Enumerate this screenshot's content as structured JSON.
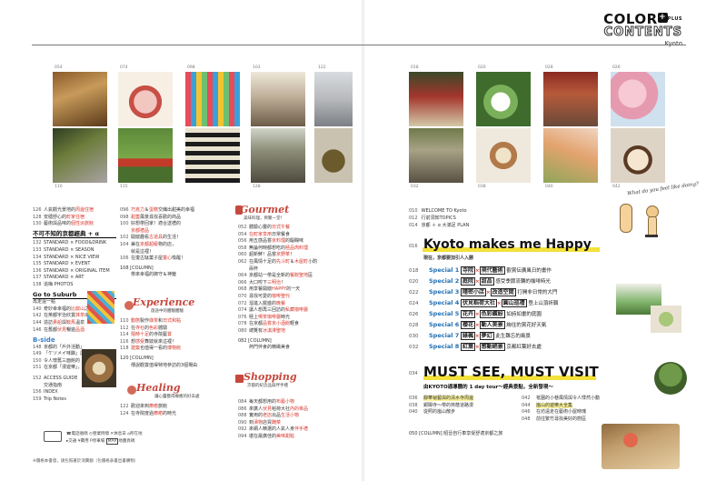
{
  "header": {
    "logo_line1": "COLOR",
    "logo_plus": "+",
    "logo_plus_word": "PLUS",
    "logo_line2": "CONTENTS",
    "logo_line3": "Kyoto"
  },
  "photo_pages": {
    "left_top": [
      "054",
      "074",
      "098",
      "103",
      "122"
    ],
    "left_bottom": [
      "110",
      "115",
      "",
      "128",
      ""
    ],
    "right_top": [
      "018",
      "020",
      "028",
      "026"
    ],
    "right_bottom": [
      "032",
      "038",
      "040",
      "042"
    ]
  },
  "col1": {
    "items_a": [
      {
        "num": "126",
        "pre": "人氣觀光景地的",
        "hl": "周邊住宿",
        "post": ""
      },
      {
        "num": "128",
        "pre": "安穩舒心的",
        "hl": "町家住宿",
        "post": ""
      },
      {
        "num": "130",
        "pre": "藝術與品味的",
        "hl": "個性派旅館",
        "post": ""
      }
    ],
    "section": "不可不知的京都經典 + α",
    "items_b": [
      {
        "num": "132",
        "text": "STANDARD × FOOD&DRINK"
      },
      {
        "num": "133",
        "text": "STANDARD × SEASON"
      },
      {
        "num": "134",
        "text": "STANDARD × NICE VIEW"
      },
      {
        "num": "135",
        "text": "STANDARD × EVENT"
      },
      {
        "num": "136",
        "text": "STANDARD × ORIGINAL ITEM"
      },
      {
        "num": "137",
        "text": "STANDARD × ART"
      },
      {
        "num": "138",
        "text": "追梅 PHOTOS"
      }
    ],
    "goto_title": "Go to Suburb",
    "goto_sub": "再走遠一點",
    "items_c": [
      {
        "num": "140",
        "pre": "奇妙幸幸福的",
        "hl": "比叡山",
        "post": "之旅"
      },
      {
        "num": "142",
        "pre": "在英都宇治欣賞",
        "hl": "抹茶",
        "post": "出品"
      },
      {
        "num": "144",
        "pre": "造訪",
        "hl": "貴船",
        "post": "與",
        "hl2": "鞍馬",
        "post2": "溫泉"
      },
      {
        "num": "146",
        "pre": "在舊都",
        "hl": "伏見",
        "post": "暢遊",
        "hl2": "品酒",
        "post2": ""
      }
    ],
    "bside_title": "B-side",
    "items_d": [
      {
        "num": "148",
        "text": "京都的「戶外活動」"
      },
      {
        "num": "149",
        "text": "「ケツメイ味醂」與傳統酒的魅力"
      },
      {
        "num": "150",
        "text": "令人懷舊三面館的「溫泉」小店"
      },
      {
        "num": "151",
        "text": "在京都「漫遊樂」，找好去處 2"
      }
    ],
    "items_e": [
      {
        "num": "152",
        "text": "ACCESS GUIDE"
      },
      {
        "num": "",
        "text": "交通指南"
      },
      {
        "num": "156",
        "text": "INDEX"
      },
      {
        "num": "159",
        "text": "Trip Notes"
      }
    ]
  },
  "col2": {
    "items_a": [
      {
        "num": "096",
        "pre": "",
        "hl": "巧克力",
        "post": "＆",
        "hl2": "蛋糕",
        "post2": "交織出甜美的幸福"
      },
      {
        "num": "098",
        "pre": "",
        "hl": "甜蓋",
        "post": "風景尋找喜歡的商品",
        "hl2": "",
        "post2": ""
      },
      {
        "num": "100",
        "pre": "好想帶回家！適合送禮的",
        "hl": "",
        "post": "",
        "hl2": "",
        "post2": ""
      },
      {
        "num": "",
        "pre": "",
        "hl": "京都禮品",
        "post": "",
        "hl2": "",
        "post2": ""
      },
      {
        "num": "102",
        "pre": "開啟趣看",
        "hl": "古道具",
        "post": "的生活！",
        "hl2": "",
        "post2": ""
      },
      {
        "num": "104",
        "pre": "兼在",
        "hl": "京都超級",
        "post": "物的店，",
        "hl2": "",
        "post2": ""
      },
      {
        "num": "",
        "pre": "就是這裡！",
        "hl": "",
        "post": "",
        "hl2": "",
        "post2": ""
      },
      {
        "num": "106",
        "pre": "在復古駄菓子屋",
        "hl": "童心",
        "post": "喚醒！",
        "hl2": "",
        "post2": ""
      }
    ],
    "column_a": "108 [COLUMN]",
    "column_a_sub": "帶來幸福的御守＆神籤",
    "experience_title": "Experience",
    "experience_sub": "旅途中的體驗體驗",
    "items_b": [
      {
        "num": "110",
        "pre": "",
        "hl": "動態",
        "post": "製作",
        "hl2": "綠茶",
        "post2": "和",
        "hl3": "日式和點"
      },
      {
        "num": "112",
        "pre": "在",
        "hl": "寺社",
        "post": "的",
        "hl2": "色彩",
        "post2": "體驗",
        "hl3": ""
      },
      {
        "num": "114",
        "pre": "",
        "hl": "隨時十足",
        "post": "的寺院藝",
        "hl2": "賞",
        "post2": "",
        "hl3": ""
      },
      {
        "num": "116",
        "pre": "想",
        "hl": "感受",
        "post": "舞妓",
        "hl2": "",
        "post2": "就來這裡！",
        "hl3": ""
      },
      {
        "num": "118",
        "pre": "",
        "hl": "建築",
        "post": "也值得一看的",
        "hl2": "博物館",
        "post2": "",
        "hl3": ""
      }
    ],
    "column_b": "120 [COLUMN]",
    "column_b_sub": "傳說觀賞值得特地參訪的3個場由",
    "healing_title": "Healing",
    "healing_sub": "讓心靈獲得療癒的好去處",
    "items_c": [
      {
        "num": "122",
        "pre": "歡迎來到",
        "hl": "療癒",
        "post": "旅館"
      },
      {
        "num": "124",
        "pre": "在寺院度過",
        "hl": "療癒",
        "post": "的時光"
      }
    ],
    "legend": [
      "電話號碼",
      "營業時間",
      "休息日",
      "所在地",
      "交通",
      "費用",
      "停車場",
      "MAP",
      "地圖頁碼"
    ]
  },
  "col3": {
    "gourmet_title": "Gourmet",
    "gourmet_sub": "美味料理，齊聚一堂！",
    "items_a": [
      {
        "num": "052",
        "pre": "體驗心靈的",
        "hl": "日式午餐",
        "post": ""
      },
      {
        "num": "054",
        "pre": "",
        "hl": "在町家享用",
        "post": "日常餐食"
      },
      {
        "num": "056",
        "pre": "用五感品嘗",
        "hl": "京料理",
        "post": "的醍醐味"
      },
      {
        "num": "058",
        "pre": "無論何時都想吃的",
        "hl": "極品肉料理",
        "post": ""
      },
      {
        "num": "060",
        "pre": "超新鮮！品嘗",
        "hl": "京野菜",
        "post": "！"
      },
      {
        "num": "062",
        "pre": "在風情十足的",
        "hl": "先斗町",
        "post": "＆",
        "hl2": "木屋町",
        "post2": "小酌"
      },
      {
        "num": "",
        "pre": "兩杯",
        "hl": "",
        "post": ""
      },
      {
        "num": "064",
        "pre": "京都站一帶是全新的",
        "hl": "餐飲聖地",
        "post": "區"
      },
      {
        "num": "066",
        "pre": "大口咬下",
        "hl": "三明治",
        "post": "！"
      },
      {
        "num": "068",
        "pre": "用享餐開啟",
        "hl": "HAPPY",
        "post": "的一天"
      },
      {
        "num": "070",
        "pre": "尋找可愛的",
        "hl": "咖啡聖代",
        "post": ""
      },
      {
        "num": "072",
        "pre": "溜進入擺盛的",
        "hl": "晚餐",
        "post": ""
      },
      {
        "num": "074",
        "pre": "讓人想再三回訪的",
        "hl": "私藏咖啡廳",
        "post": ""
      },
      {
        "num": "076",
        "pre": "極上",
        "hl": "喫茶咖啡廳",
        "post": "時光"
      },
      {
        "num": "078",
        "pre": "在京都",
        "hl": "品嘗京小酒館",
        "post": "輕食"
      },
      {
        "num": "080",
        "pre": "總覽有",
        "hl": "冰淇淋聖地",
        "post": ""
      }
    ],
    "column": "082 [COLUMN]",
    "column_sub": "熱門伴食的精緻美食",
    "shopping_title": "Shopping",
    "shopping_sub": "京都的紀念品與伴手禮",
    "items_b": [
      {
        "num": "084",
        "pre": "每天都想用的",
        "hl": "布藝小物",
        "post": ""
      },
      {
        "num": "086",
        "pre": "來廣人",
        "hl": "伏見",
        "post": "稻荷大社",
        "hl2": "內的單品",
        "post2": ""
      },
      {
        "num": "088",
        "pre": "實用的",
        "hl": "老店",
        "post": "出品",
        "hl2": "生活小物",
        "post2": ""
      },
      {
        "num": "090",
        "pre": "到",
        "hl": "漬物",
        "post": "店買",
        "hl2": "醃菜",
        "post2": ""
      },
      {
        "num": "092",
        "pre": "來網人精選的人氣人身",
        "hl": "伴手禮",
        "post": "",
        "hl2": "",
        "post2": ""
      },
      {
        "num": "094",
        "pre": "堪在最廣佳的",
        "hl": "美味甜點",
        "post": "",
        "hl2": "",
        "post2": ""
      }
    ]
  },
  "right": {
    "intro": [
      {
        "num": "010",
        "text": "WELCOME TO Kyoto"
      },
      {
        "num": "012",
        "text": "行前須知TOPICS"
      },
      {
        "num": "014",
        "text": "京都 ＋ α 大滿足 PLAN"
      }
    ],
    "happy_num": "016",
    "happy_title": "Kyoto makes me Happy",
    "happy_sub": "現在，京都要加引人入勝",
    "specials": [
      {
        "num": "018",
        "sp": "Special 1",
        "a": "寺院",
        "b": "現代藝術",
        "text": "觀賞伝廣風日的畫作"
      },
      {
        "num": "020",
        "sp": "Special 2",
        "a": "庭院",
        "b": "甜品",
        "text": "感受季節流轉的咖啡時光"
      },
      {
        "num": "022",
        "sp": "Special 3",
        "a": "隱密小店",
        "b": "改造空間",
        "text": "打開非日常的大門"
      },
      {
        "num": "024",
        "sp": "Special 4",
        "a": "伏見稻荷大社",
        "b": "圓山巡禮",
        "text": "登上山頂祈願"
      },
      {
        "num": "026",
        "sp": "Special 5",
        "a": "花卉",
        "b": "色彩繽紛",
        "text": "如詩如畫的庭園"
      },
      {
        "num": "028",
        "sp": "Special 6",
        "a": "櫻花",
        "b": "動人美景",
        "text": "絢往的賞花好天氣"
      },
      {
        "num": "030",
        "sp": "Special 7",
        "a": "綠楓",
        "b": "夢幻",
        "text": "此生難忘的風景"
      },
      {
        "num": "032",
        "sp": "Special 8",
        "a": "紅葉",
        "b": "感動絕景",
        "text": "京都紅葉好去處"
      }
    ],
    "must_num": "034",
    "must_title": "MUST SEE, MUST VISIT",
    "must_sub": "由KYOTO通導體的 1 day tour～經典景點，全新發現～",
    "must_left": [
      {
        "num": "036",
        "text": "靜華祕藝與的清水寺周邊"
      },
      {
        "num": "038",
        "text": "銀閣寺～帶的林蔭道路漫"
      },
      {
        "num": "040",
        "text": "從照的嵐山散步"
      }
    ],
    "must_right": [
      {
        "num": "042",
        "text": "祇園的小巷風情與令人悸然小動"
      },
      {
        "num": "044",
        "text": "嵐山的遊樂大全集"
      },
      {
        "num": "046",
        "text": "在坊遠走在藝術小屋時瑰"
      },
      {
        "num": "048",
        "text": "前往繁竹尋找美好的廚區"
      }
    ],
    "column": "050 [COLUMN] 昭晉自行車享受舒適京都之旅",
    "speech": "What do you feel like doing?"
  },
  "footer": {
    "note": "※價格本書發，請包照著於消費額（包價格表書出書購物）"
  },
  "colors": {
    "accent_red": "#d8352a",
    "highlight_yellow": "#f4e13a",
    "blue": "#1f6fb3"
  }
}
